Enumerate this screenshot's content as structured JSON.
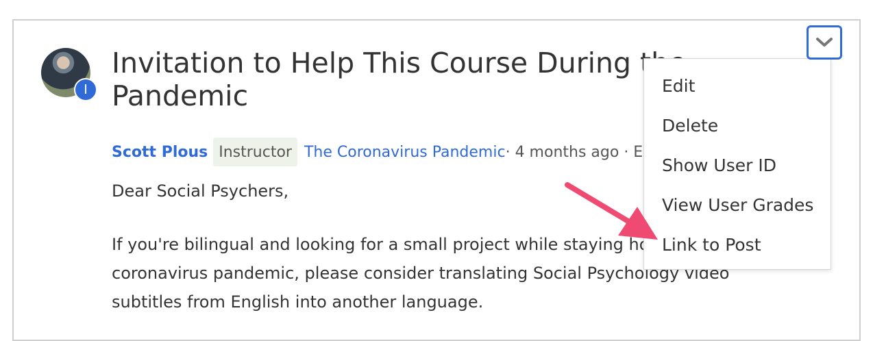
{
  "post": {
    "title": "Invitation to Help This Course During the Pandemic",
    "avatar_badge": "I",
    "author": "Scott Plous",
    "role": "Instructor",
    "topic": "The Coronavirus Pandemic",
    "meta": " · 4 months ago · E",
    "paragraphs": [
      "Dear Social Psychers,",
      "If you're bilingual and looking for a small project while staying home during the coronavirus pandemic, please consider translating Social Psychology video subtitles from English into another language."
    ]
  },
  "menu": {
    "toggle_icon": "chevron-down-icon",
    "items": [
      {
        "label": "Edit"
      },
      {
        "label": "Delete"
      },
      {
        "label": "Show User ID"
      },
      {
        "label": "View User Grades"
      },
      {
        "label": "Link to Post"
      }
    ]
  },
  "colors": {
    "accent": "#2f6ad6",
    "annotation_arrow": "#ee4a72"
  }
}
